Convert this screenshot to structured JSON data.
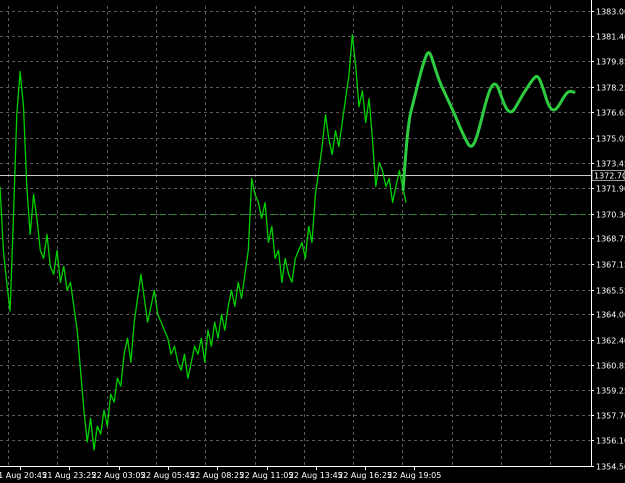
{
  "chart_data": {
    "type": "line",
    "title": "",
    "xlabel": "",
    "ylabel": "",
    "ylim": [
      1354.5,
      1383.3
    ],
    "grid": true,
    "colors": {
      "background": "#000000",
      "grid": "#5a5a5a",
      "price": "#00d000",
      "forecast": "#2ecc40",
      "level_line": "#c8c8c8",
      "dashed_level": "#2a8a2a",
      "axis_text": "#ffffff",
      "marker_bg": "#000000"
    },
    "y_ticks": [
      1383.0,
      1381.4,
      1379.85,
      1378.25,
      1376.65,
      1375.05,
      1373.45,
      1371.9,
      1370.3,
      1368.75,
      1367.15,
      1365.55,
      1364.0,
      1362.4,
      1360.85,
      1359.25,
      1357.7,
      1356.1,
      1354.5
    ],
    "y_tick_labels": [
      "1383.00",
      "1381.40",
      "1379.85",
      "1378.25",
      "1376.65",
      "1375.05",
      "1373.45",
      "1371.90",
      "1370.30",
      "1368.75",
      "1367.15",
      "1365.55",
      "1364.00",
      "1362.40",
      "1360.85",
      "1359.25",
      "1357.70",
      "1356.10",
      "1354.50"
    ],
    "x_tick_labels": [
      "21 Aug 20:45",
      "21 Aug 23:25",
      "22 Aug 03:05",
      "22 Aug 05:45",
      "22 Aug 08:25",
      "22 Aug 11:05",
      "22 Aug 13:45",
      "22 Aug 16:25",
      "22 Aug 19:05"
    ],
    "current_price_label": "1372.70",
    "current_price": 1372.7,
    "dashed_level": 1370.3,
    "series": [
      {
        "values": [
          1372.0,
          1368.0,
          1366.0,
          1364.2,
          1370.0,
          1376.5,
          1379.2,
          1377.0,
          1372.0,
          1369.0,
          1371.5,
          1370.0,
          1368.0,
          1367.5,
          1369.0,
          1367.0,
          1366.5,
          1368.0,
          1366.0,
          1367.0,
          1365.5,
          1366.0,
          1364.5,
          1363.0,
          1360.5,
          1358.0,
          1356.0,
          1357.5,
          1355.5,
          1357.0,
          1356.5,
          1358.0,
          1357.0,
          1359.0,
          1358.5,
          1360.0,
          1359.5,
          1361.5,
          1362.5,
          1361.0,
          1363.5,
          1365.0,
          1366.5,
          1365.0,
          1363.5,
          1364.5,
          1365.5,
          1364.0,
          1363.5,
          1363.0,
          1362.5,
          1361.5,
          1362.0,
          1361.0,
          1360.5,
          1361.5,
          1360.0,
          1361.0,
          1362.0,
          1361.5,
          1362.5,
          1361.0,
          1363.0,
          1362.0,
          1363.5,
          1362.5,
          1364.0,
          1363.0,
          1364.5,
          1365.5,
          1364.5,
          1366.0,
          1365.0,
          1366.5,
          1368.0,
          1372.5,
          1371.5,
          1371.0,
          1370.0,
          1371.0,
          1368.5,
          1369.5,
          1367.5,
          1368.0,
          1366.0,
          1367.5,
          1366.5,
          1366.0,
          1367.5,
          1368.0,
          1368.5,
          1367.5,
          1369.5,
          1368.5,
          1371.5,
          1373.0,
          1374.5,
          1376.5,
          1375.0,
          1374.0,
          1375.5,
          1374.5,
          1376.0,
          1377.5,
          1379.0,
          1381.5,
          1379.5,
          1377.0,
          1378.0,
          1376.0,
          1377.5,
          1375.0,
          1372.0,
          1373.5,
          1373.0,
          1372.0,
          1372.5,
          1371.0,
          1372.0,
          1373.0,
          1372.0,
          1371.0
        ],
        "color": "price"
      },
      {
        "values": [
          1371.8,
          1376.0,
          1377.3,
          1378.6,
          1379.8,
          1380.6,
          1379.6,
          1378.6,
          1377.9,
          1377.2,
          1376.5,
          1375.7,
          1375.0,
          1374.4,
          1374.8,
          1376.0,
          1377.3,
          1378.3,
          1378.5,
          1377.6,
          1376.8,
          1376.6,
          1377.1,
          1377.7,
          1378.2,
          1378.7,
          1379.0,
          1378.2,
          1377.1,
          1376.7,
          1377.0,
          1377.6,
          1378.0,
          1377.9
        ],
        "color": "forecast"
      }
    ]
  }
}
